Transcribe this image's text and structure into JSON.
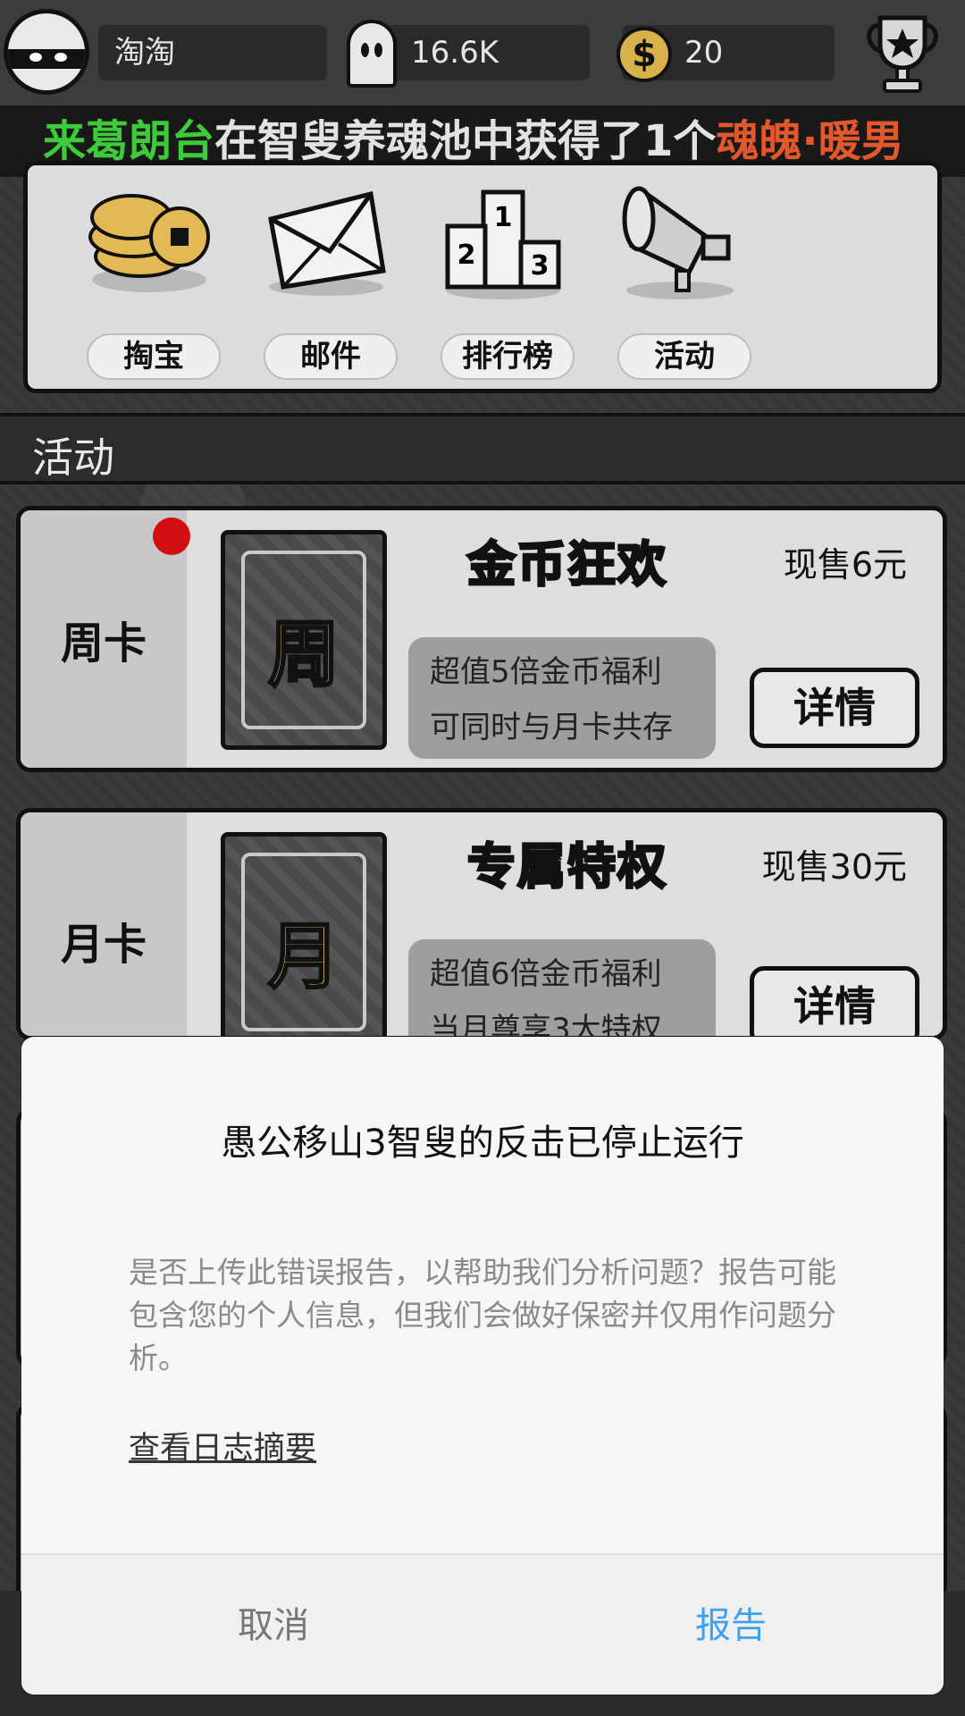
{
  "topbar": {
    "player_name": "淘淘",
    "souls": "16.6K",
    "coins": "20",
    "coin_symbol": "$"
  },
  "marquee": {
    "player": "来葛朗台",
    "middle": "在智叟养魂池中获得了1个",
    "item": "魂魄·暖男"
  },
  "shortcuts": [
    {
      "label": "掏宝",
      "icon": "gold-coins-icon"
    },
    {
      "label": "邮件",
      "icon": "envelope-icon"
    },
    {
      "label": "排行榜",
      "icon": "podium-icon"
    },
    {
      "label": "活动",
      "icon": "megaphone-icon"
    }
  ],
  "section": {
    "title": "活动"
  },
  "cards": [
    {
      "side_label": "周卡",
      "glyph": "周",
      "title": "金币狂欢",
      "price": "现售6元",
      "desc_line1": "超值5倍金币福利",
      "desc_line2": "可同时与月卡共存",
      "button": "详情",
      "has_notification": true
    },
    {
      "side_label": "月卡",
      "glyph": "月",
      "title": "专属特权",
      "price": "现售30元",
      "desc_line1": "超值6倍金币福利",
      "desc_line2": "当月尊享3大特权",
      "button": "详情",
      "has_notification": false
    }
  ],
  "dialog": {
    "title": "愚公移山3智叟的反击已停止运行",
    "message": "是否上传此错误报告，以帮助我们分析问题？报告可能包含您的个人信息，但我们会做好保密并仅用作问题分析。",
    "link": "查看日志摘要",
    "cancel": "取消",
    "report": "报告"
  },
  "colors": {
    "accent_blue": "#3fa0f0",
    "marquee_green": "#3ecb3a",
    "marquee_orange": "#e0582b",
    "gold": "#e3b955",
    "notification_red": "#d30f14"
  }
}
